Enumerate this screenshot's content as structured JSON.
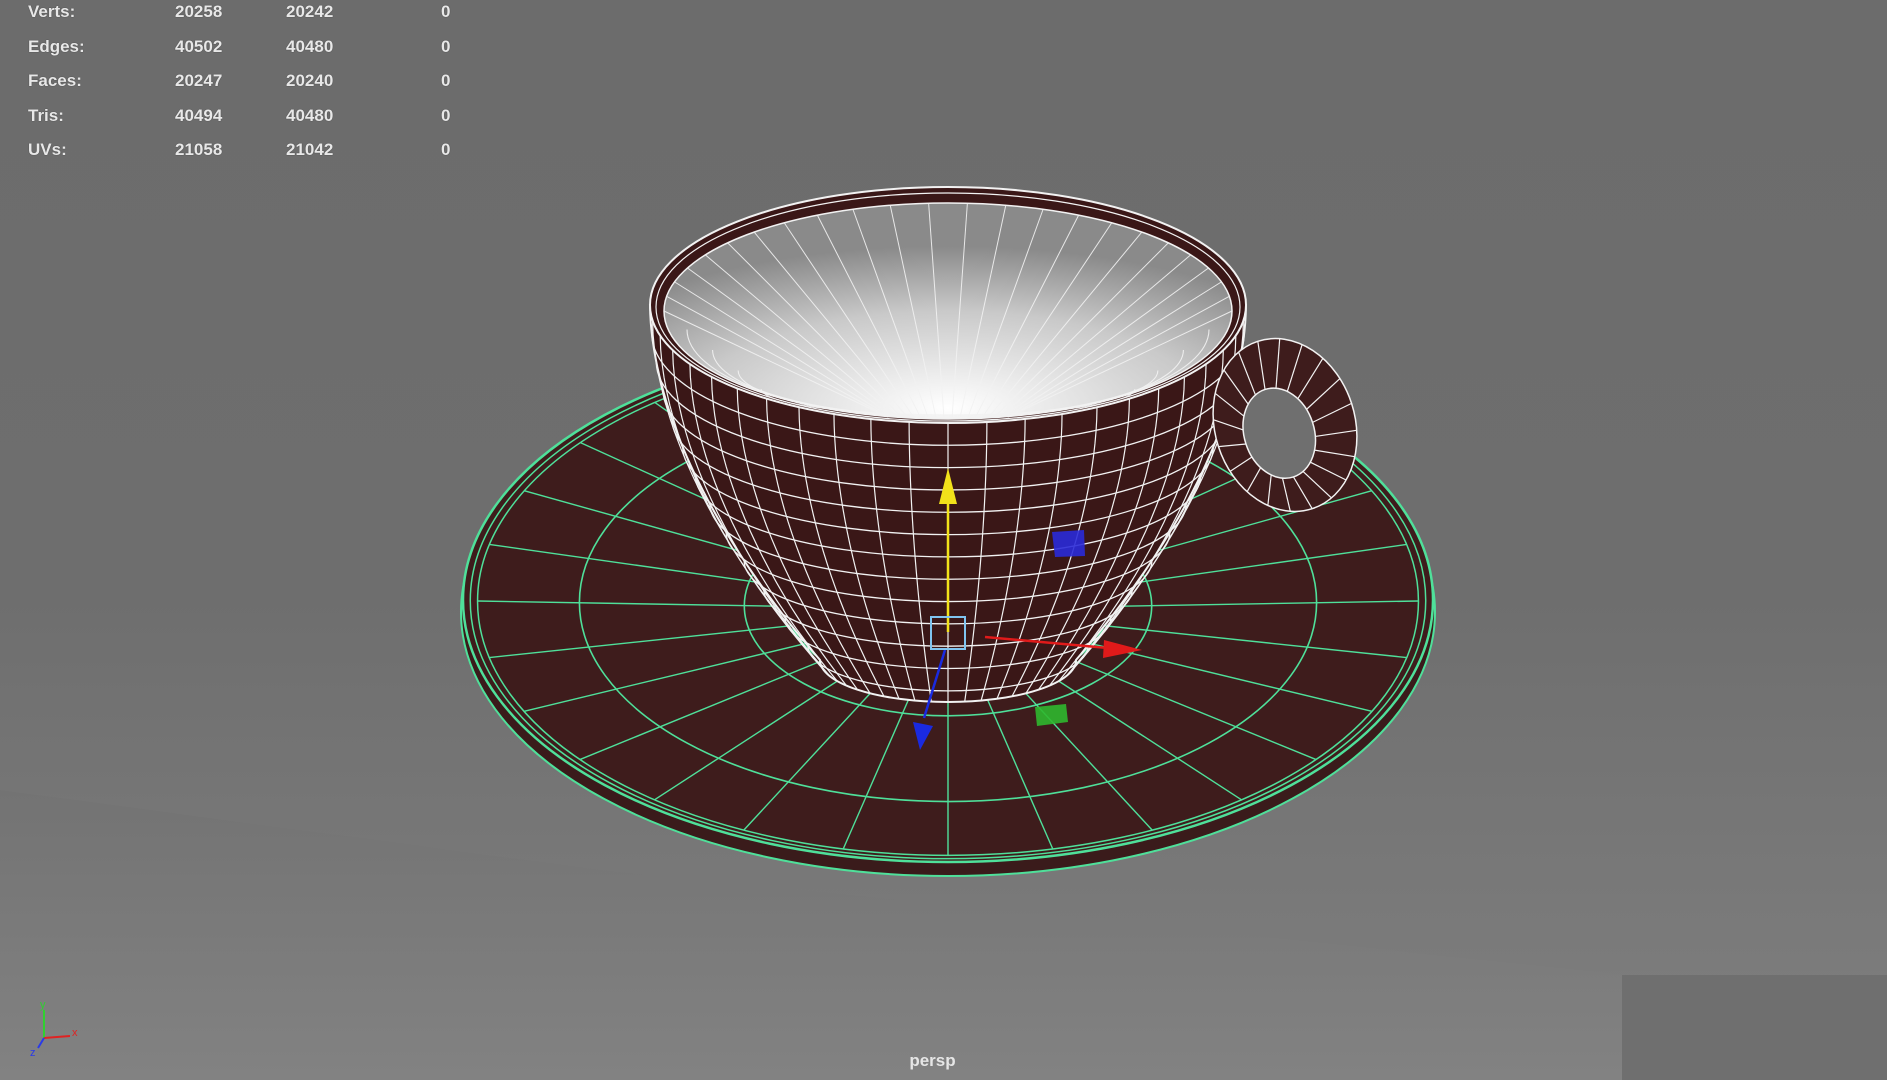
{
  "hud": {
    "rows": [
      {
        "label": "Verts:",
        "c1": "20258",
        "c2": "20242",
        "c3": "0"
      },
      {
        "label": "Edges:",
        "c1": "40502",
        "c2": "40480",
        "c3": "0"
      },
      {
        "label": "Faces:",
        "c1": "20247",
        "c2": "20240",
        "c3": "0"
      },
      {
        "label": "Tris:",
        "c1": "40494",
        "c2": "40480",
        "c3": "0"
      },
      {
        "label": "UVs:",
        "c1": "21058",
        "c2": "21042",
        "c3": "0"
      }
    ]
  },
  "viewport": {
    "camera_name": "persp"
  },
  "axis_gizmo": {
    "x_label": "x",
    "y_label": "y",
    "z_label": "z"
  },
  "colors": {
    "background": "#6f6f6f",
    "selection_wire": "#4fe09a",
    "cup_wire": "#f2f2f2",
    "surface": "#3e1c1c",
    "manip_x": "#e01a1a",
    "manip_y": "#f2e21a",
    "manip_z": "#1a2ae0"
  }
}
